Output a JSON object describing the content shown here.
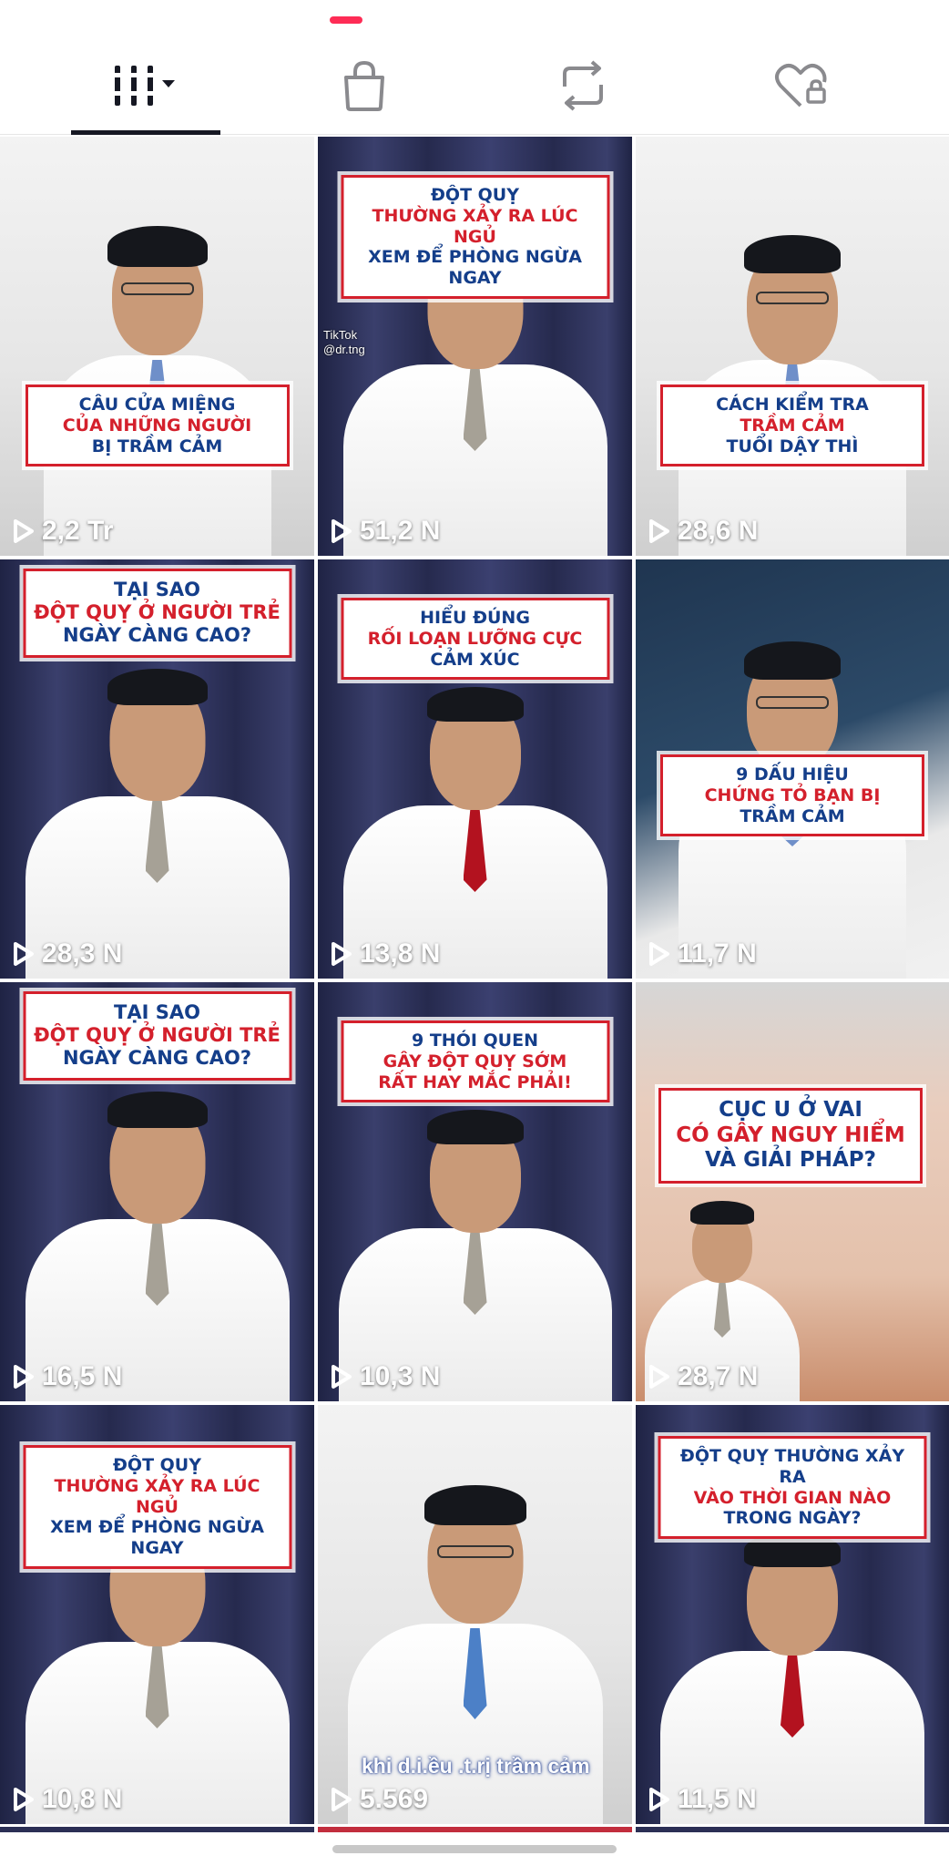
{
  "tabs": [
    {
      "name": "videos",
      "icon": "grid-icon",
      "active": true
    },
    {
      "name": "shop",
      "icon": "shopping-bag-icon",
      "active": false
    },
    {
      "name": "reposts",
      "icon": "repost-icon",
      "active": false
    },
    {
      "name": "liked",
      "icon": "heart-lock-icon",
      "active": false
    }
  ],
  "videos": [
    {
      "views": "2,2 Tr",
      "caption": [
        "CÂU CỬA MIỆNG",
        "CỦA NHỮNG NGƯỜI",
        "BỊ TRẦM CẢM"
      ]
    },
    {
      "views": "51,2 N",
      "caption": [
        "ĐỘT QUỴ",
        "THƯỜNG XẢY RA LÚC NGỦ",
        "XEM ĐỂ PHÒNG NGỪA NGAY"
      ],
      "watermark": "TikTok",
      "watermark_handle": "@dr.tng"
    },
    {
      "views": "28,6 N",
      "caption": [
        "CÁCH KIỂM TRA",
        "TRẦM CẢM",
        "TUỔI DẬY THÌ"
      ]
    },
    {
      "views": "28,3 N",
      "caption": [
        "TẠI SAO",
        "ĐỘT QUỴ Ở NGƯỜI TRẺ",
        "NGÀY CÀNG CAO?"
      ]
    },
    {
      "views": "13,8 N",
      "caption": [
        "HIỂU ĐÚNG",
        "RỐI LOẠN LƯỠNG CỰC",
        "CẢM XÚC"
      ]
    },
    {
      "views": "11,7 N",
      "caption": [
        "9 DẤU HIỆU",
        "CHỨNG TỎ BẠN BỊ",
        "TRẦM CẢM"
      ]
    },
    {
      "views": "16,5 N",
      "caption": [
        "TẠI SAO",
        "ĐỘT QUỴ Ở NGƯỜI TRẺ",
        "NGÀY CÀNG CAO?"
      ]
    },
    {
      "views": "10,3 N",
      "caption": [
        "9 THÓI QUEN",
        "GÂY ĐỘT QUỴ SỚM",
        "RẤT HAY MẮC PHẢI!"
      ]
    },
    {
      "views": "28,7 N",
      "caption": [
        "CỤC U Ở VAI",
        "CÓ GÂY NGUY HIỂM",
        "VÀ GIẢI PHÁP?"
      ]
    },
    {
      "views": "10,8 N",
      "caption": [
        "ĐỘT QUỴ",
        "THƯỜNG XẢY RA LÚC NGỦ",
        "XEM ĐỂ PHÒNG NGỪA NGAY"
      ]
    },
    {
      "views": "5.569",
      "caption": [],
      "subtitle": "khi d.i.ều .t.rị trầm cảm"
    },
    {
      "views": "11,5 N",
      "caption": [
        "ĐỘT QUỴ THƯỜNG XẢY RA",
        "VÀO THỜI GIAN NÀO",
        "TRONG NGÀY?"
      ]
    }
  ],
  "colors": {
    "accent": "#fe2c55",
    "caption_red": "#d4202c",
    "caption_blue": "#143e8a",
    "text": "#161823"
  }
}
